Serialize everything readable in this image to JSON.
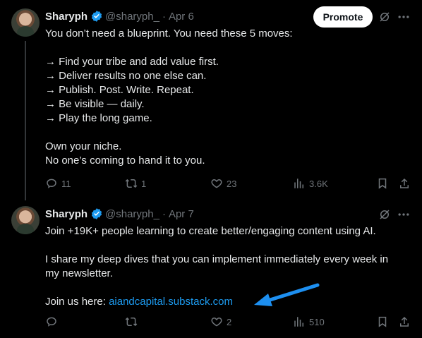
{
  "posts": [
    {
      "name": "Sharyph",
      "handle": "@sharyph_",
      "separator": "·",
      "date": "Apr 6",
      "promote_label": "Promote",
      "lines": [
        "You don’t need a blueprint. You need these 5 moves:",
        "",
        "→ Find your tribe and add value first.",
        "→ Deliver results no one else can.",
        "→ Publish. Post. Write. Repeat.",
        "→ Be visible — daily.",
        "→ Play the long game.",
        "",
        "Own your niche.",
        "No one’s coming to hand it to you."
      ],
      "replies": "11",
      "reposts": "1",
      "likes": "23",
      "views": "3.6K"
    },
    {
      "name": "Sharyph",
      "handle": "@sharyph_",
      "separator": "·",
      "date": "Apr 7",
      "lines": [
        "Join +19K+ people learning to create better/engaging content using AI.",
        "",
        "I share my deep dives that you can implement immediately every week in",
        "my newsletter.",
        ""
      ],
      "join_text": "Join us here: ",
      "link_text": "aiandcapital.substack.com",
      "replies": "",
      "reposts": "",
      "likes": "2",
      "views": "510"
    }
  ],
  "colors": {
    "background": "#000000",
    "text": "#e7e9ea",
    "muted": "#71767b",
    "accent": "#1d9bf0",
    "arrow": "#1d8ff0"
  },
  "icons": [
    "verified-badge-icon",
    "grok-icon",
    "more-icon",
    "reply-icon",
    "repost-icon",
    "like-icon",
    "views-icon",
    "bookmark-icon",
    "share-icon",
    "arrow-annotation"
  ]
}
